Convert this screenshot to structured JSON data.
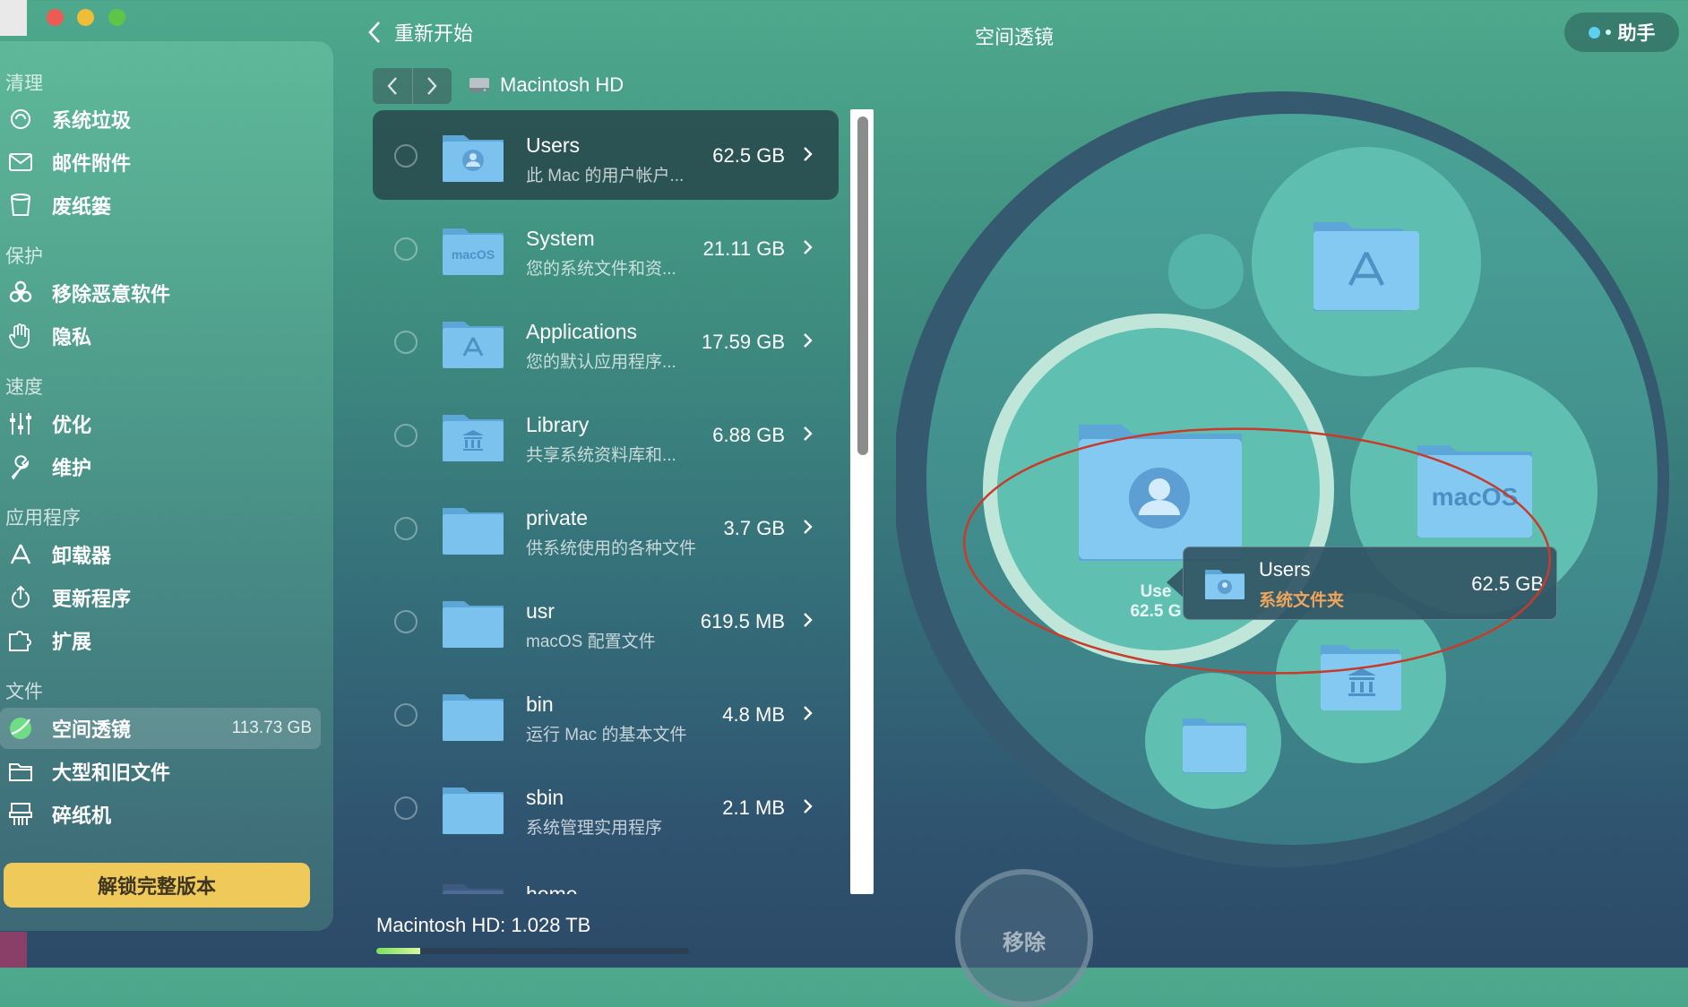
{
  "app": {
    "assistant_label": "助手",
    "back_label": "重新开始",
    "page_title": "空间透镜"
  },
  "breadcrumb": {
    "disk_name": "Macintosh HD"
  },
  "sidebar": {
    "sections": [
      {
        "title": "清理",
        "items": [
          {
            "label": "系统垃圾",
            "icon": "system-junk-icon"
          },
          {
            "label": "邮件附件",
            "icon": "mail-icon"
          },
          {
            "label": "废纸篓",
            "icon": "trash-icon"
          }
        ]
      },
      {
        "title": "保护",
        "items": [
          {
            "label": "移除恶意软件",
            "icon": "biohazard-icon"
          },
          {
            "label": "隐私",
            "icon": "hand-icon"
          }
        ]
      },
      {
        "title": "速度",
        "items": [
          {
            "label": "优化",
            "icon": "sliders-icon"
          },
          {
            "label": "维护",
            "icon": "wrench-icon"
          }
        ]
      },
      {
        "title": "应用程序",
        "items": [
          {
            "label": "卸载器",
            "icon": "uninstaller-icon"
          },
          {
            "label": "更新程序",
            "icon": "updater-icon"
          },
          {
            "label": "扩展",
            "icon": "extensions-icon"
          }
        ]
      },
      {
        "title": "文件",
        "items": [
          {
            "label": "空间透镜",
            "icon": "space-lens-icon",
            "size": "113.73 GB",
            "active": true
          },
          {
            "label": "大型和旧文件",
            "icon": "folder-icon"
          },
          {
            "label": "碎纸机",
            "icon": "shredder-icon"
          }
        ]
      }
    ],
    "unlock_label": "解锁完整版本"
  },
  "files": [
    {
      "name": "Users",
      "desc": "此 Mac 的用户帐户...",
      "size": "62.5 GB",
      "icon": "user-folder-icon",
      "selected": true
    },
    {
      "name": "System",
      "desc": "您的系统文件和资...",
      "size": "21.11 GB",
      "icon": "macos-folder-icon"
    },
    {
      "name": "Applications",
      "desc": "您的默认应用程序...",
      "size": "17.59 GB",
      "icon": "apps-folder-icon"
    },
    {
      "name": "Library",
      "desc": "共享系统资料库和...",
      "size": "6.88 GB",
      "icon": "library-folder-icon"
    },
    {
      "name": "private",
      "desc": "供系统使用的各种文件",
      "size": "3.7 GB",
      "icon": "folder-icon"
    },
    {
      "name": "usr",
      "desc": "macOS 配置文件",
      "size": "619.5 MB",
      "icon": "folder-icon"
    },
    {
      "name": "bin",
      "desc": "运行 Mac 的基本文件",
      "size": "4.8 MB",
      "icon": "folder-icon"
    },
    {
      "name": "sbin",
      "desc": "系统管理实用程序",
      "size": "2.1 MB",
      "icon": "folder-icon"
    },
    {
      "name": "home",
      "desc": "",
      "size": "",
      "icon": "server-folder-icon"
    }
  ],
  "disk": {
    "label": "Macintosh HD: 1.028 TB",
    "used_fraction": 0.14
  },
  "lens": {
    "macos_text": "macOS",
    "users_label": "Use",
    "users_size": "62.5 G",
    "tooltip": {
      "name": "Users",
      "kind": "系统文件夹",
      "size": "62.5 GB"
    }
  },
  "remove_label": "移除",
  "colors": {
    "unlock": "#efc95a",
    "tooltip_kind": "#f0a55a",
    "annotation": "#c83b2a"
  }
}
